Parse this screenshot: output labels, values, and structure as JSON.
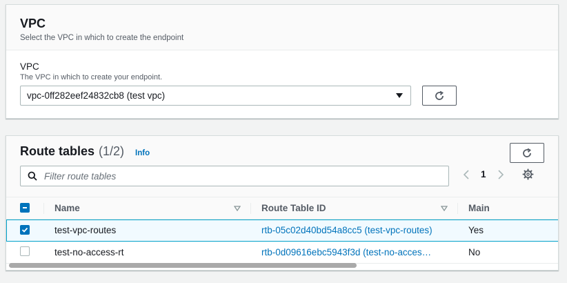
{
  "vpc_section": {
    "title": "VPC",
    "description": "Select the VPC in which to create the endpoint",
    "field_label": "VPC",
    "field_description": "The VPC in which to create your endpoint.",
    "selected_vpc": "vpc-0ff282eef24832cb8 (test vpc)"
  },
  "route_tables": {
    "title": "Route tables",
    "count": "(1/2)",
    "info_label": "Info",
    "filter_placeholder": "Filter route tables",
    "current_page": "1",
    "columns": {
      "name": "Name",
      "id": "Route Table ID",
      "main": "Main"
    },
    "rows": [
      {
        "name": "test-vpc-routes",
        "id": "rtb-05c02d40bd54a8cc5 (test-vpc-routes)",
        "main": "Yes",
        "selected": true
      },
      {
        "name": "test-no-access-rt",
        "id": "rtb-0d09616ebc5943f3d (test-no-acces…",
        "main": "No",
        "selected": false
      }
    ]
  },
  "colors": {
    "accent": "#0073bb",
    "selected_row_bg": "#f1faff",
    "selected_border": "#00a1c9"
  }
}
